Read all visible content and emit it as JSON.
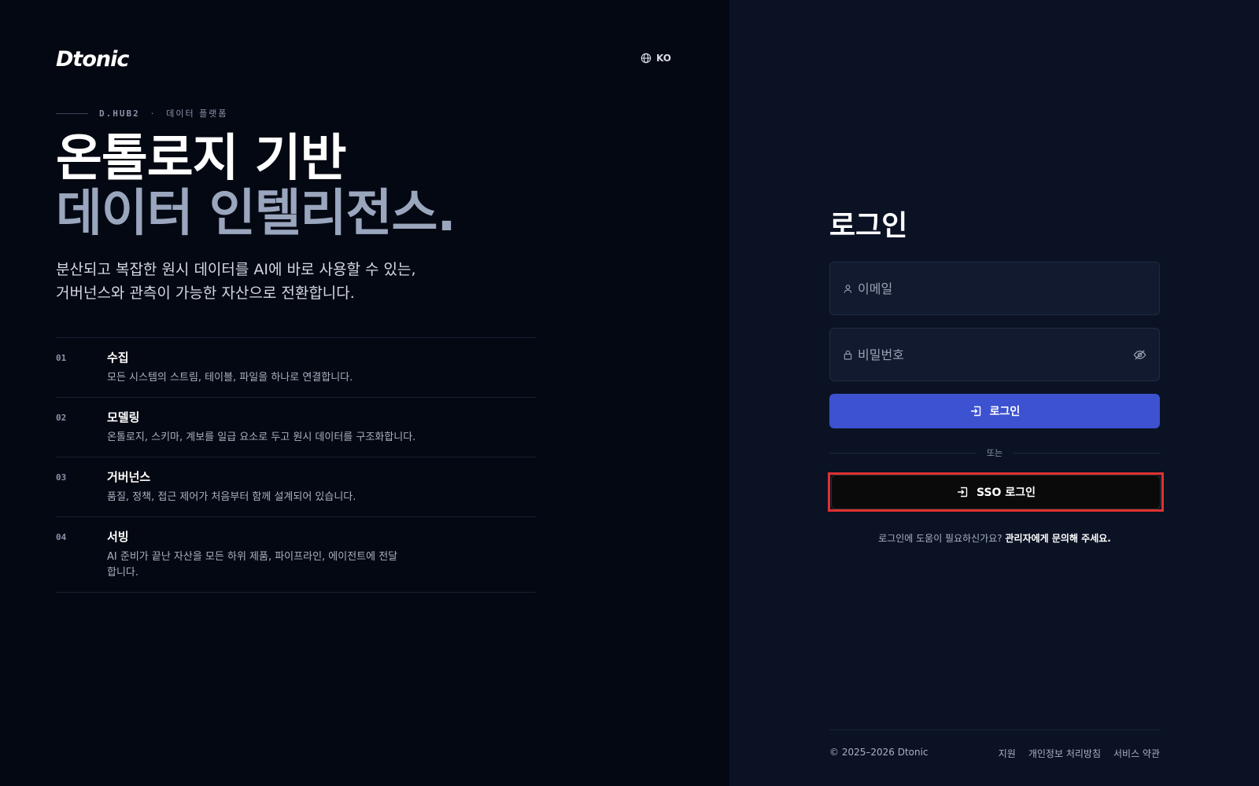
{
  "brand": {
    "logo": "Dtonic"
  },
  "language": {
    "label": "KO"
  },
  "hero": {
    "eyebrow_code": "D.HUB2",
    "eyebrow_sep": "·",
    "eyebrow_text": "데이터 플랫폼",
    "headline_line1": "온톨로지 기반",
    "headline_line2": "데이터 인텔리전스.",
    "lead_line1": "분산되고 복잡한 원시 데이터를 AI에 바로 사용할 수 있는,",
    "lead_line2": "거버넌스와 관측이 가능한 자산으로 전환합니다."
  },
  "features": [
    {
      "num": "01",
      "title": "수집",
      "desc": "모든 시스템의 스트림, 테이블, 파일을 하나로 연결합니다."
    },
    {
      "num": "02",
      "title": "모델링",
      "desc": "온톨로지, 스키마, 계보를 일급 요소로 두고 원시 데이터를 구조화합니다."
    },
    {
      "num": "03",
      "title": "거버넌스",
      "desc": "품질, 정책, 접근 제어가 처음부터 함께 설계되어 있습니다."
    },
    {
      "num": "04",
      "title": "서빙",
      "desc": "AI 준비가 끝난 자산을 모든 하위 제품, 파이프라인, 에이전트에 전달합니다."
    }
  ],
  "login": {
    "title": "로그인",
    "email_placeholder": "이메일",
    "password_placeholder": "비밀번호",
    "submit_label": "로그인",
    "divider_label": "또는",
    "sso_label": "SSO 로그인",
    "help_text": "로그인에 도움이 필요하신가요? ",
    "help_link": "관리자에게 문의해 주세요."
  },
  "footer": {
    "copyright": "© 2025–2026 Dtonic",
    "links": [
      "지원",
      "개인정보 처리방침",
      "서비스 약관"
    ]
  },
  "colors": {
    "primary": "#3d52d0",
    "highlight": "#e03131"
  },
  "icons": [
    "globe-icon",
    "user-icon",
    "lock-icon",
    "eye-off-icon",
    "login-icon",
    "sso-login-icon"
  ]
}
